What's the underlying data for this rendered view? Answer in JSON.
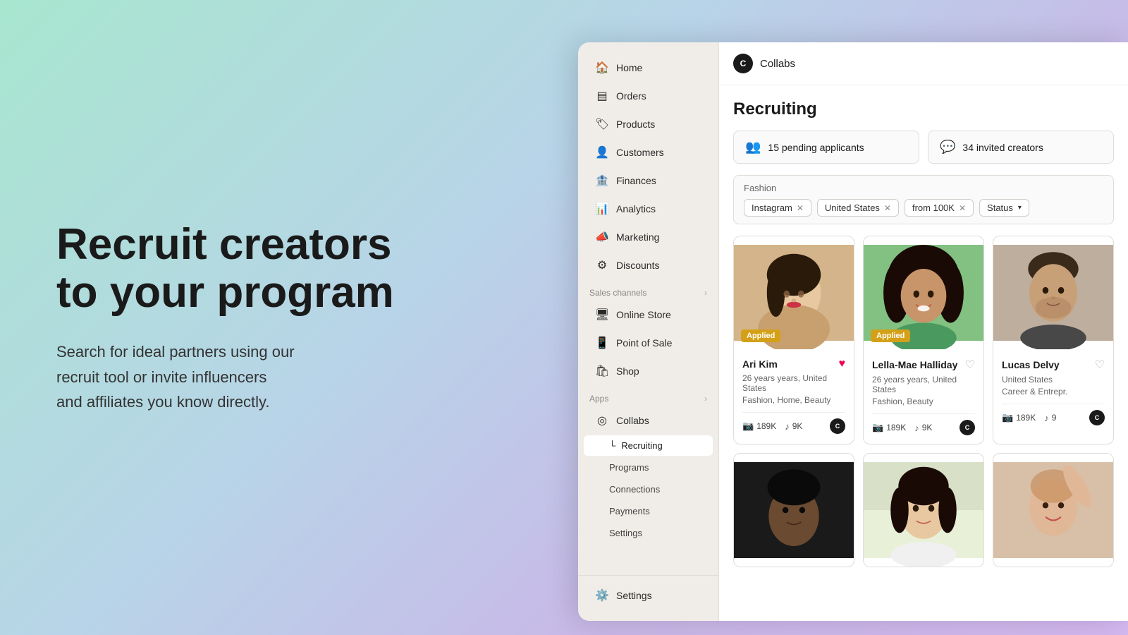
{
  "background": {
    "gradient": "linear-gradient(135deg, #a8e6cf 0%, #b8d4e8 40%, #c9b8e8 70%, #d4b8f0 100%)"
  },
  "hero": {
    "title": "Recruit creators\nto your program",
    "subtitle": "Search for ideal partners using our\nrecruit tool or invite influencers\nand affiliates you know directly."
  },
  "sidebar": {
    "items": [
      {
        "id": "home",
        "label": "Home",
        "icon": "🏠"
      },
      {
        "id": "orders",
        "label": "Orders",
        "icon": "📋"
      },
      {
        "id": "products",
        "label": "Products",
        "icon": "🏷️"
      },
      {
        "id": "customers",
        "label": "Customers",
        "icon": "👤"
      },
      {
        "id": "finances",
        "label": "Finances",
        "icon": "🏦"
      },
      {
        "id": "analytics",
        "label": "Analytics",
        "icon": "📊"
      },
      {
        "id": "marketing",
        "label": "Marketing",
        "icon": "📣"
      },
      {
        "id": "discounts",
        "label": "Discounts",
        "icon": "🏷️"
      }
    ],
    "sales_channels_label": "Sales channels",
    "sales_channel_items": [
      {
        "id": "online-store",
        "label": "Online Store",
        "icon": "🖥️"
      },
      {
        "id": "point-of-sale",
        "label": "Point of Sale",
        "icon": "📱"
      },
      {
        "id": "shop",
        "label": "Shop",
        "icon": "🛍️"
      }
    ],
    "apps_label": "Apps",
    "app_items": [
      {
        "id": "collabs",
        "label": "Collabs",
        "icon": "◎"
      }
    ],
    "sub_items": [
      {
        "id": "recruiting",
        "label": "Recruiting",
        "active": true
      },
      {
        "id": "programs",
        "label": "Programs"
      },
      {
        "id": "connections",
        "label": "Connections"
      },
      {
        "id": "payments",
        "label": "Payments"
      },
      {
        "id": "settings-sub",
        "label": "Settings"
      }
    ],
    "bottom": {
      "label": "Settings",
      "icon": "⚙️"
    }
  },
  "topbar": {
    "app_name": "Collabs"
  },
  "page": {
    "title": "Recruiting",
    "pending_label": "15 pending applicants",
    "invited_label": "34 invited creators",
    "filter_category": "Fashion",
    "filters": [
      {
        "id": "instagram",
        "label": "Instagram",
        "removable": true
      },
      {
        "id": "united-states",
        "label": "United States",
        "removable": true
      },
      {
        "id": "from-100k",
        "label": "from 100K",
        "removable": true
      },
      {
        "id": "status",
        "label": "Status",
        "removable": false,
        "has_chevron": true
      }
    ],
    "creators": [
      {
        "id": "ari-kim",
        "name": "Ari Kim",
        "age": "26 years",
        "location": "United States",
        "tags": "Fashion, Home, Beauty",
        "instagram_followers": "189K",
        "tiktok_followers": "9K",
        "applied": true,
        "favorited": true,
        "image_style": "ari"
      },
      {
        "id": "lella-mae-halliday",
        "name": "Lella-Mae Halliday",
        "age": "26 years",
        "location": "United States",
        "tags": "Fashion, Beauty",
        "instagram_followers": "189K",
        "tiktok_followers": "9K",
        "applied": true,
        "favorited": false,
        "image_style": "lella"
      },
      {
        "id": "lucas-delvy",
        "name": "Lucas Delvy",
        "age": "",
        "location": "United States",
        "tags": "Career & Entrepr.",
        "instagram_followers": "189K",
        "tiktok_followers": "9",
        "applied": false,
        "favorited": false,
        "image_style": "lucas"
      },
      {
        "id": "creator-4",
        "name": "",
        "age": "",
        "location": "",
        "tags": "",
        "instagram_followers": "",
        "tiktok_followers": "",
        "applied": false,
        "favorited": false,
        "image_style": "dark"
      },
      {
        "id": "creator-5",
        "name": "",
        "age": "",
        "location": "",
        "tags": "",
        "instagram_followers": "",
        "tiktok_followers": "",
        "applied": false,
        "favorited": false,
        "image_style": "light"
      },
      {
        "id": "creator-6",
        "name": "",
        "age": "",
        "location": "",
        "tags": "",
        "instagram_followers": "",
        "tiktok_followers": "",
        "applied": false,
        "favorited": false,
        "image_style": "warm"
      }
    ]
  }
}
